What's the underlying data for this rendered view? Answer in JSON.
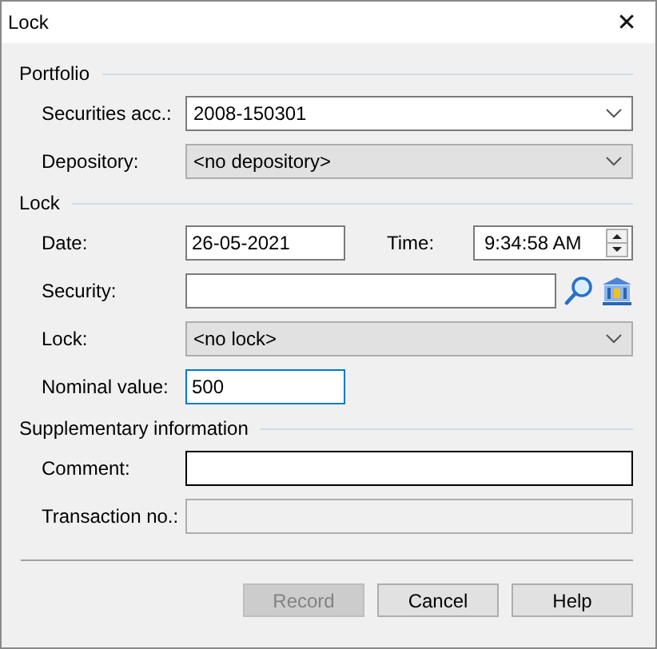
{
  "window": {
    "title": "Lock",
    "close": "✕"
  },
  "sections": [
    {
      "title": "Portfolio",
      "rows": [
        {
          "kind": "combo",
          "label": "Securities acc.:",
          "value": "2008-150301",
          "disabled": false
        },
        {
          "kind": "combo",
          "label": "Depository:",
          "value": "<no depository>",
          "disabled": true
        }
      ]
    },
    {
      "title": "Lock",
      "rows": [
        {
          "kind": "datetime",
          "label": "Date:",
          "value": "26-05-2021",
          "time_label": "Time:",
          "time_value": "9:34:58 AM"
        },
        {
          "kind": "lookup",
          "label": "Security:",
          "value": ""
        },
        {
          "kind": "combo",
          "label": "Lock:",
          "value": "<no lock>",
          "disabled": true
        },
        {
          "kind": "short",
          "label": "Nominal value:",
          "value": "500",
          "focused": true
        }
      ]
    },
    {
      "title": "Supplementary information",
      "rows": [
        {
          "kind": "text",
          "label": "Comment:",
          "value": "",
          "disabled": false,
          "dark_border": true
        },
        {
          "kind": "text",
          "label": "Transaction no.:",
          "value": "",
          "disabled": true,
          "dark_border": false
        }
      ]
    }
  ],
  "buttons": [
    {
      "label": "Record",
      "disabled": true
    },
    {
      "label": "Cancel",
      "disabled": false
    },
    {
      "label": "Help",
      "disabled": false
    }
  ]
}
